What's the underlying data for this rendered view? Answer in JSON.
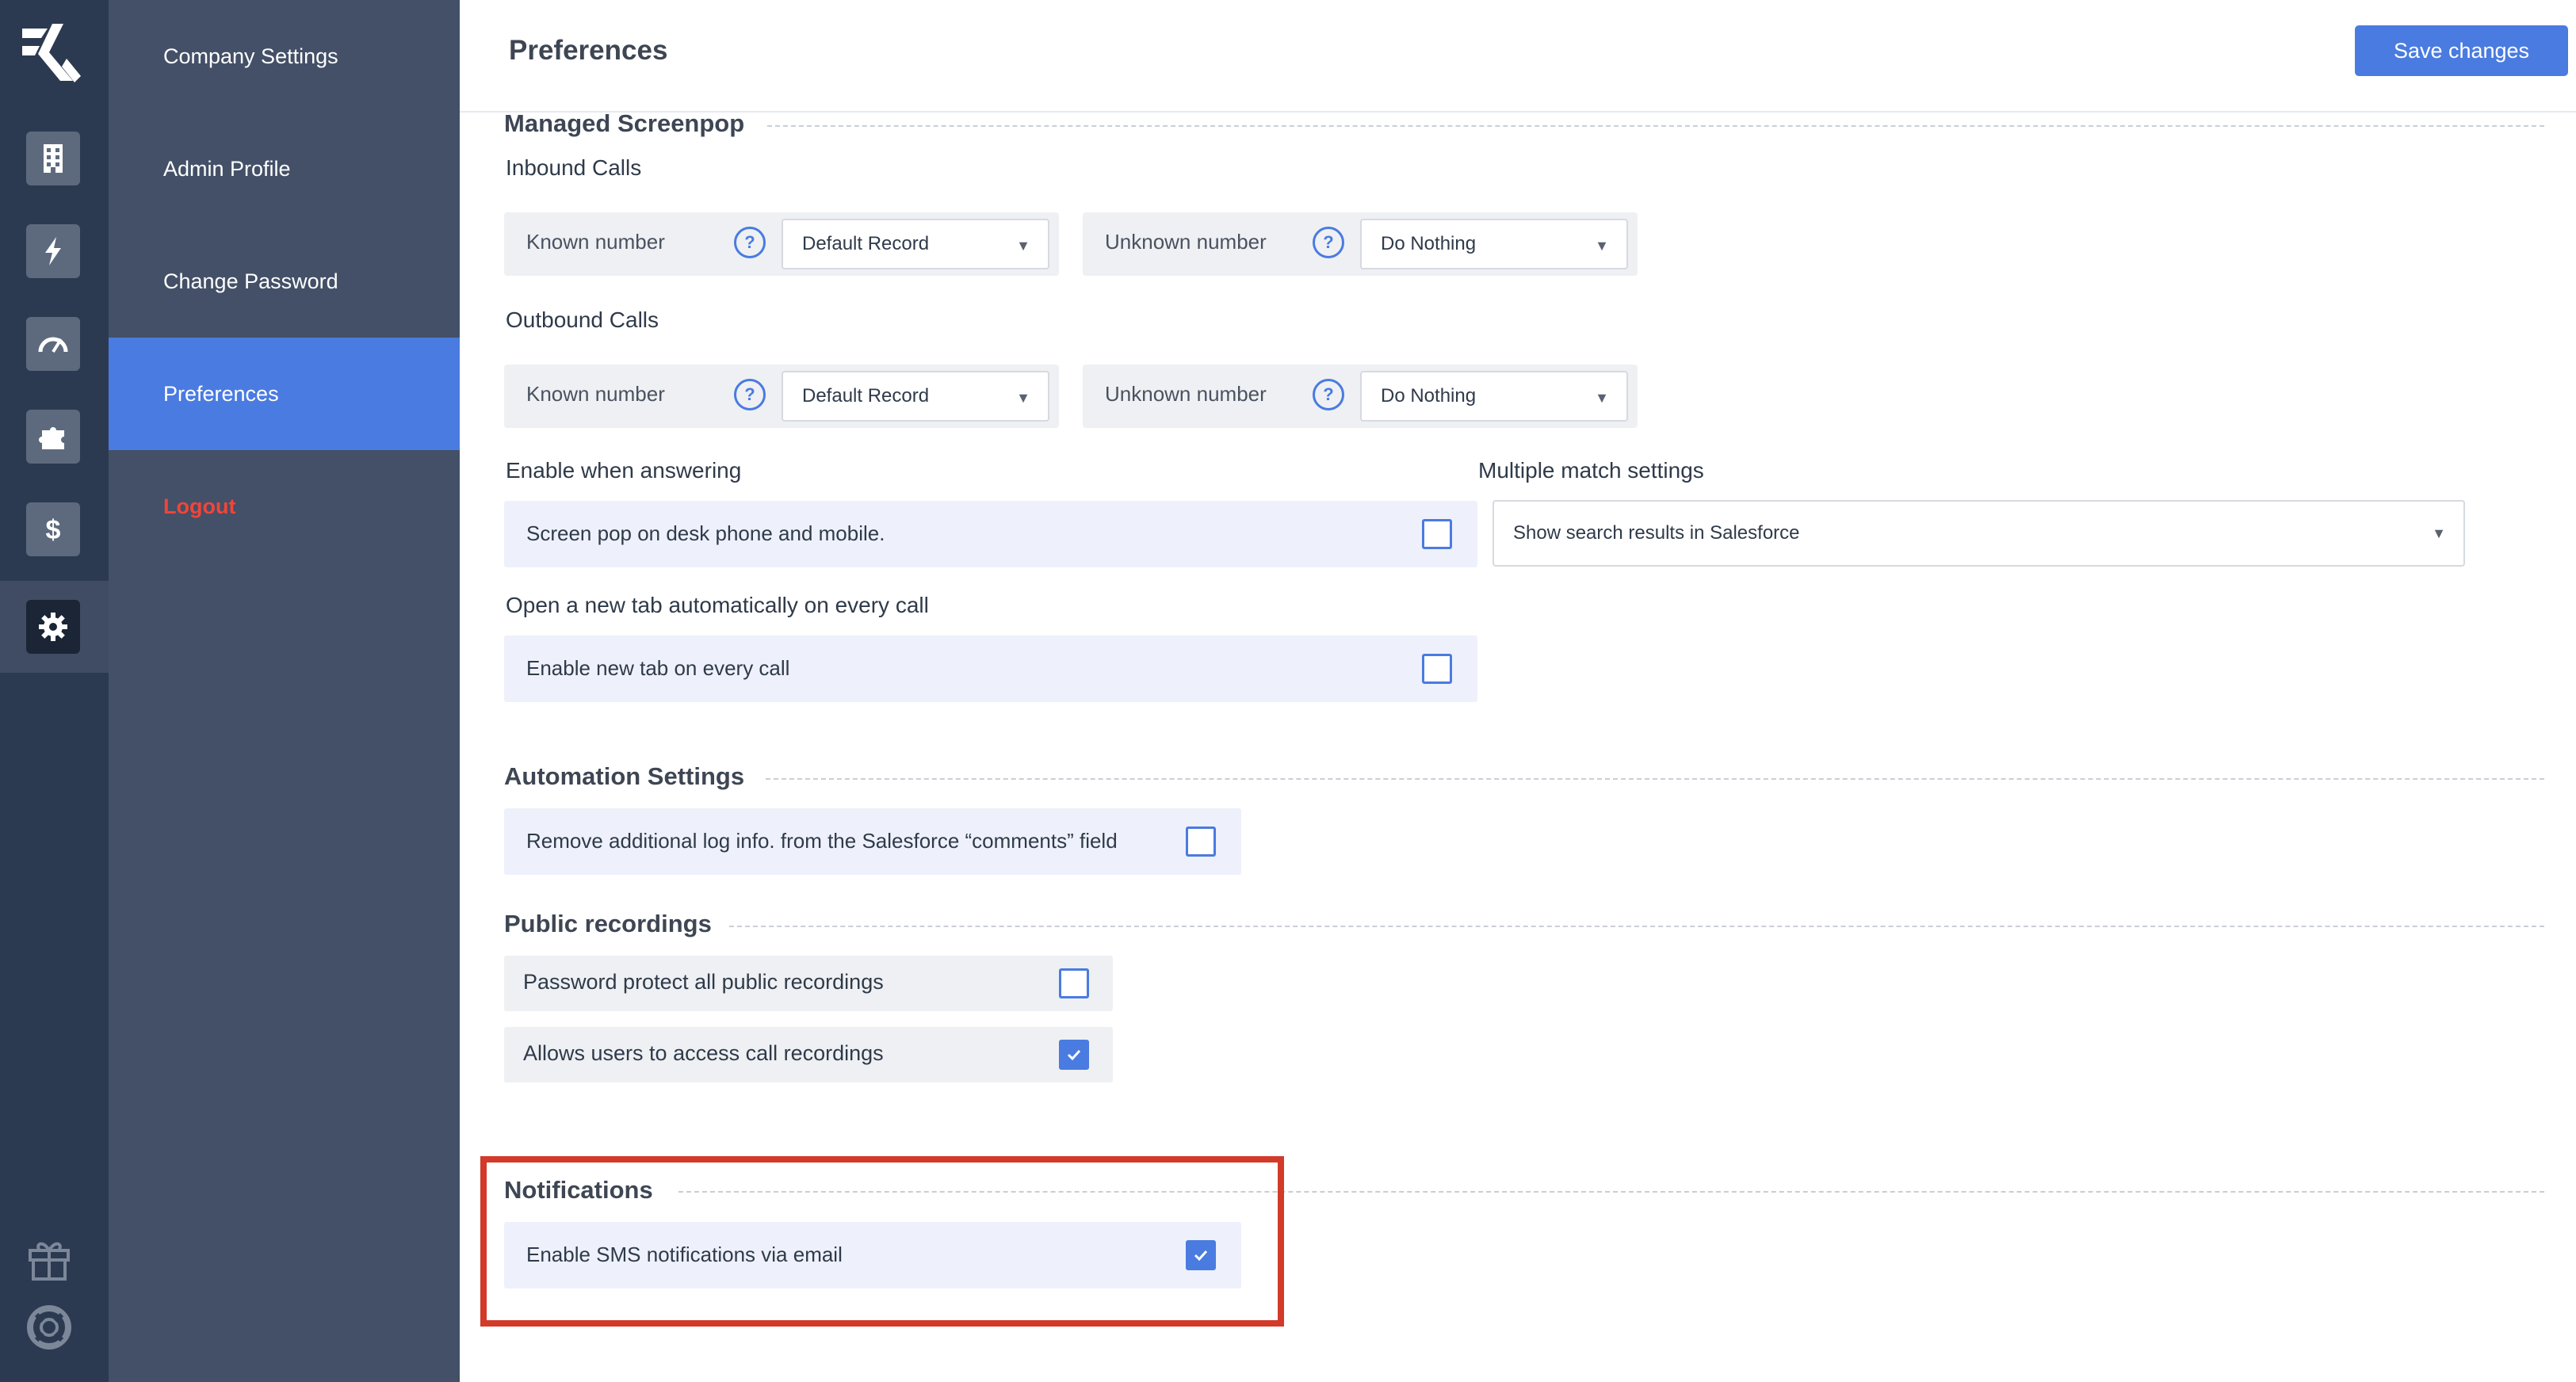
{
  "rail": {
    "icons": [
      "logo-icon",
      "building-icon",
      "lightning-icon",
      "gauge-icon",
      "puzzle-icon",
      "dollar-icon",
      "gear-icon",
      "gift-icon",
      "lifebuoy-icon"
    ]
  },
  "subnav": {
    "items": [
      {
        "label": "Company Settings"
      },
      {
        "label": "Admin Profile"
      },
      {
        "label": "Change Password"
      },
      {
        "label": "Preferences",
        "active": true
      },
      {
        "label": "Logout"
      }
    ]
  },
  "header": {
    "title": "Preferences",
    "save_label": "Save changes"
  },
  "screenpop": {
    "title": "Managed Screenpop",
    "inbound": {
      "title": "Inbound Calls",
      "known_label": "Known number",
      "known_value": "Default Record",
      "unknown_label": "Unknown number",
      "unknown_value": "Do Nothing"
    },
    "outbound": {
      "title": "Outbound Calls",
      "known_label": "Known number",
      "known_value": "Default Record",
      "unknown_label": "Unknown number",
      "unknown_value": "Do Nothing"
    },
    "answering": {
      "title": "Enable when answering",
      "option_label": "Screen pop on desk phone and mobile.",
      "checked": false
    },
    "multiple_match": {
      "title": "Multiple match settings",
      "value": "Show search results in Salesforce"
    },
    "new_tab": {
      "title": "Open a new tab automatically on every call",
      "option_label": "Enable new tab on every call",
      "checked": false
    }
  },
  "automation": {
    "title": "Automation Settings",
    "option_label": "Remove additional log info. from the Salesforce “comments” field",
    "checked": false
  },
  "recordings": {
    "title": "Public recordings",
    "options": [
      {
        "label": "Password protect all public recordings",
        "checked": false
      },
      {
        "label": "Allows users to access call recordings",
        "checked": true
      }
    ]
  },
  "notifications": {
    "title": "Notifications",
    "option_label": "Enable SMS notifications via email",
    "checked": true
  },
  "colors": {
    "accent": "#4a7be0",
    "rail_bg": "#2c3a51",
    "subnav_bg": "#435067",
    "logout": "#f0453a",
    "highlight": "#d23a2a"
  }
}
